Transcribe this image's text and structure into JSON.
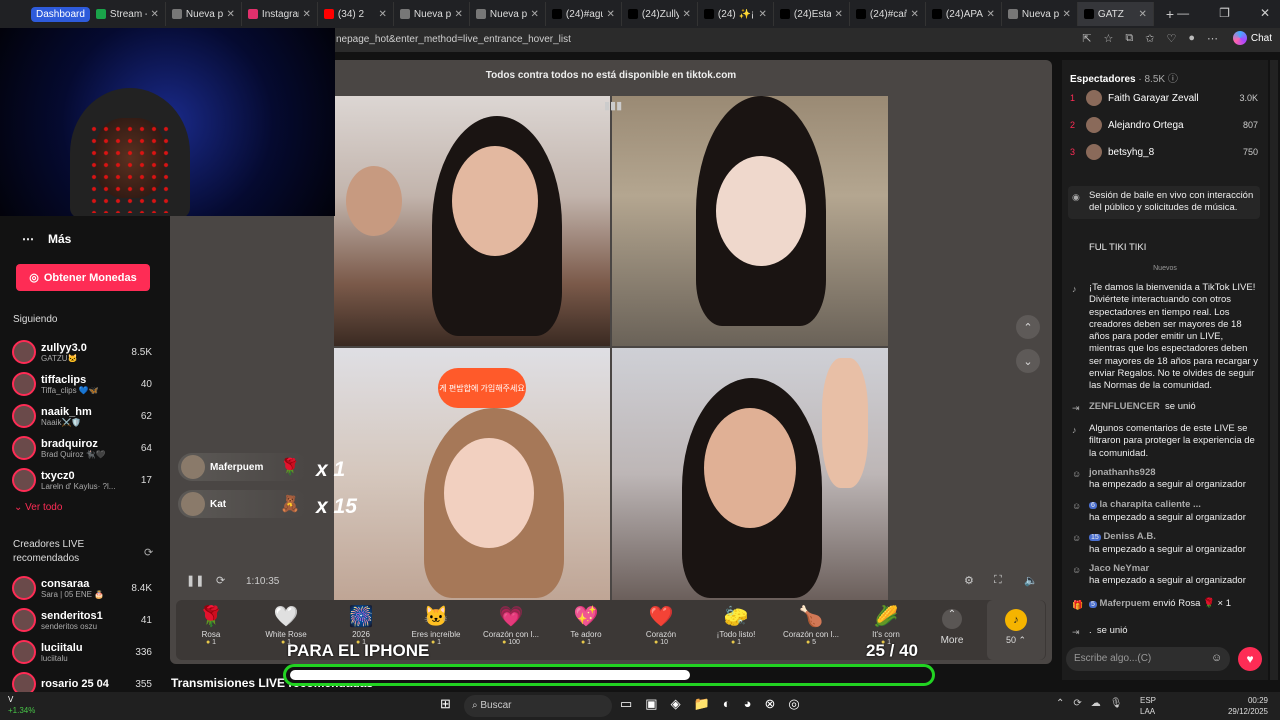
{
  "tabs": [
    {
      "title": "Dashboard",
      "color": "#2e5bdb"
    },
    {
      "title": "Stream - K",
      "color": "#1aa34a"
    },
    {
      "title": "Nueva pe",
      "color": "#777"
    },
    {
      "title": "Instagram",
      "color": "#e1306c"
    },
    {
      "title": "(34) 2",
      "color": "#ff0000"
    },
    {
      "title": "Nueva pe",
      "color": "#777"
    },
    {
      "title": "Nueva pe",
      "color": "#777"
    },
    {
      "title": "(24)#agus",
      "color": "#000"
    },
    {
      "title": "(24)Zully",
      "color": "#000"
    },
    {
      "title": "(24) ✨¡Bi",
      "color": "#000"
    },
    {
      "title": "(24)Esta c",
      "color": "#000"
    },
    {
      "title": "(24)#cañit",
      "color": "#000"
    },
    {
      "title": "(24)APARI",
      "color": "#000"
    },
    {
      "title": "Nueva pe",
      "color": "#777"
    },
    {
      "title": "GATZ",
      "color": "#000"
    }
  ],
  "address": {
    "url": "nepage_hot&enter_method=live_entrance_hover_list",
    "chat_label": "Chat"
  },
  "sidebar": {
    "mas": "Más",
    "coins_button": "Obtener Monedas",
    "following_title": "Siguiendo",
    "following": [
      {
        "name": "zullyy3.0",
        "sub": "GATZU🐱",
        "count": "8.5K"
      },
      {
        "name": "tiffaclips",
        "sub": "Tiffa_clips 💙🦋",
        "count": "40"
      },
      {
        "name": "naaik_hm",
        "sub": "Naaik⚔️🛡️",
        "count": "62"
      },
      {
        "name": "bradquiroz",
        "sub": "Brad Quiroz 🐈‍⬛🖤",
        "count": "64"
      },
      {
        "name": "txycz0",
        "sub": "Lareln d' Kaylus· ?l...",
        "count": "17"
      }
    ],
    "ver_todo": "Ver todo",
    "creators_title": "Creadores LIVE recomendados",
    "creators": [
      {
        "name": "consaraa",
        "sub": "Sara | 05 ENE 🎂",
        "count": "8.4K"
      },
      {
        "name": "senderitos1",
        "sub": "senderitos oszu",
        "count": "41"
      },
      {
        "name": "luciitalu",
        "sub": "luciitalu",
        "count": "336"
      },
      {
        "name": "rosario 25 04",
        "sub": "",
        "count": "355"
      }
    ]
  },
  "main": {
    "banner": "Todos contra todos no está disponible en tiktok.com",
    "sign_text": "게 편밤합에 가입해주세요",
    "time": "1:10:35",
    "gift_floats": [
      {
        "user": "Maferpuem",
        "icon": "🌹",
        "mult": "x 1"
      },
      {
        "user": "Kat",
        "icon": "🧸",
        "mult": "x 15"
      }
    ],
    "gifts": [
      {
        "name": "Rosa",
        "icon": "🌹",
        "price": "1"
      },
      {
        "name": "White Rose",
        "icon": "🤍",
        "price": "1"
      },
      {
        "name": "2026",
        "icon": "🎆",
        "price": "1"
      },
      {
        "name": "Eres increíble",
        "icon": "🐱",
        "price": "1"
      },
      {
        "name": "Corazón con l...",
        "icon": "💗",
        "price": "100"
      },
      {
        "name": "Te adoro",
        "icon": "💖",
        "price": "1"
      },
      {
        "name": "Corazón",
        "icon": "❤️",
        "price": "10"
      },
      {
        "name": "¡Todo listo!",
        "icon": "🧽",
        "price": "1"
      },
      {
        "name": "Corazón con l...",
        "icon": "🍗",
        "price": "5"
      },
      {
        "name": "It's corn",
        "icon": "🌽",
        "price": "1"
      }
    ],
    "more_label": "More",
    "coin_balance": "50",
    "overlay_text": "PARA EL IPHONE",
    "counter": "25 / 40",
    "progress_fraction": 0.625,
    "below_title": "Transmisiones LIVE recomendadas"
  },
  "right": {
    "viewers_title": "Espectadores",
    "viewers_count": "· 8.5K",
    "viewers": [
      {
        "rank": "1",
        "name": "Faith Garayar Zevall",
        "value": "3.0K"
      },
      {
        "rank": "2",
        "name": "Alejandro Ortega",
        "value": "807"
      },
      {
        "rank": "3",
        "name": "betsyhg_8",
        "value": "750"
      }
    ],
    "session_text": "Sesión de baile en vivo con interacción del público y solicitudes de música.",
    "ful_tiki": "FUL TIKI TIKI",
    "nuevos": "Nuevos",
    "welcome": "¡Te damos la bienvenida a TikTok LIVE! Diviértete interactuando con otros espectadores en tiempo real. Los creadores deben ser mayores de 18 años para poder emitir un LIVE, mientras que los espectadores deben ser mayores de 18 años para recargar y enviar Regalos. No te olvides de seguir las Normas de la comunidad.",
    "zen_user": "ZENFLUENCER",
    "zen_action": "se unió",
    "filtered": "Algunos comentarios de este LIVE se filtraron para proteger la experiencia de la comunidad.",
    "follows": [
      {
        "user": "jonathanhs928",
        "badge": "",
        "action": "ha empezado a seguir al organizador"
      },
      {
        "user": "la charapita caliente ...",
        "badge": "6",
        "action": "ha empezado a seguir al organizador"
      },
      {
        "user": "Deniss A.B.",
        "badge": "15",
        "action": "ha empezado a seguir al organizador"
      },
      {
        "user": "Jaco NeYmar",
        "badge": "",
        "action": "ha empezado a seguir al organizador"
      }
    ],
    "gift_msg_user": "Maferpuem",
    "gift_msg_badge": "5",
    "gift_msg_text": "envió Rosa 🌹 × 1",
    "last_user": ".",
    "last_action": "se unió",
    "chat_placeholder": "Escribe algo...(C)"
  },
  "taskbar": {
    "stock_name": "V",
    "stock_pct": "+1.34%",
    "search": "Buscar",
    "lang1": "ESP",
    "lang2": "LAA",
    "time": "00:29",
    "date": "29/12/2025"
  }
}
